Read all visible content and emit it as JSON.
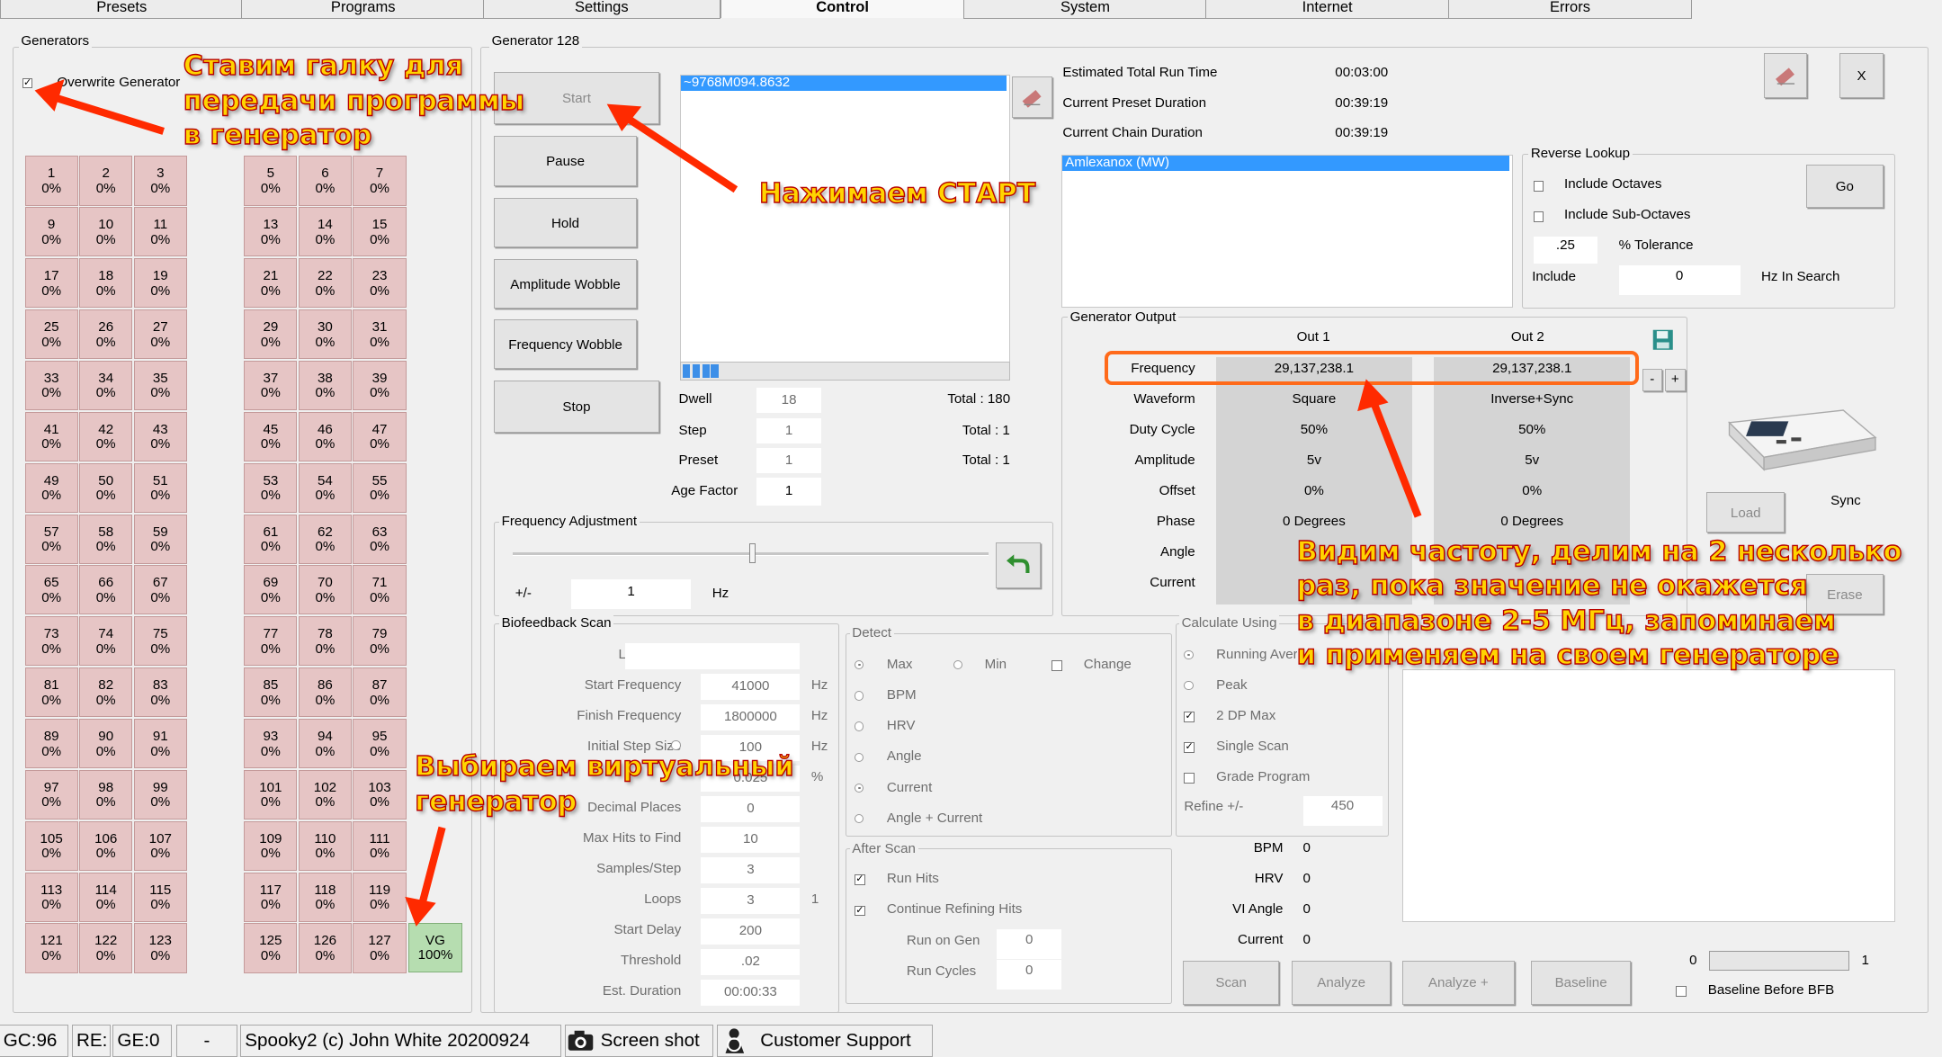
{
  "tabs": [
    {
      "label": "Presets"
    },
    {
      "label": "Programs"
    },
    {
      "label": "Settings"
    },
    {
      "label": "Control"
    },
    {
      "label": "System"
    },
    {
      "label": "Internet"
    },
    {
      "label": "Errors"
    }
  ],
  "generators": {
    "title": "Generators",
    "overwrite_label": "Overwrite Generator",
    "overwrite_checked": true,
    "cells_left": [
      {
        "num": "1",
        "pct": "0%"
      },
      {
        "num": "2",
        "pct": "0%"
      },
      {
        "num": "3",
        "pct": "0%"
      },
      {
        "num": "9",
        "pct": "0%"
      },
      {
        "num": "10",
        "pct": "0%"
      },
      {
        "num": "11",
        "pct": "0%"
      },
      {
        "num": "17",
        "pct": "0%"
      },
      {
        "num": "18",
        "pct": "0%"
      },
      {
        "num": "19",
        "pct": "0%"
      },
      {
        "num": "25",
        "pct": "0%"
      },
      {
        "num": "26",
        "pct": "0%"
      },
      {
        "num": "27",
        "pct": "0%"
      },
      {
        "num": "33",
        "pct": "0%"
      },
      {
        "num": "34",
        "pct": "0%"
      },
      {
        "num": "35",
        "pct": "0%"
      },
      {
        "num": "41",
        "pct": "0%"
      },
      {
        "num": "42",
        "pct": "0%"
      },
      {
        "num": "43",
        "pct": "0%"
      },
      {
        "num": "49",
        "pct": "0%"
      },
      {
        "num": "50",
        "pct": "0%"
      },
      {
        "num": "51",
        "pct": "0%"
      },
      {
        "num": "57",
        "pct": "0%"
      },
      {
        "num": "58",
        "pct": "0%"
      },
      {
        "num": "59",
        "pct": "0%"
      },
      {
        "num": "65",
        "pct": "0%"
      },
      {
        "num": "66",
        "pct": "0%"
      },
      {
        "num": "67",
        "pct": "0%"
      },
      {
        "num": "73",
        "pct": "0%"
      },
      {
        "num": "74",
        "pct": "0%"
      },
      {
        "num": "75",
        "pct": "0%"
      },
      {
        "num": "81",
        "pct": "0%"
      },
      {
        "num": "82",
        "pct": "0%"
      },
      {
        "num": "83",
        "pct": "0%"
      },
      {
        "num": "89",
        "pct": "0%"
      },
      {
        "num": "90",
        "pct": "0%"
      },
      {
        "num": "91",
        "pct": "0%"
      },
      {
        "num": "97",
        "pct": "0%"
      },
      {
        "num": "98",
        "pct": "0%"
      },
      {
        "num": "99",
        "pct": "0%"
      },
      {
        "num": "105",
        "pct": "0%"
      },
      {
        "num": "106",
        "pct": "0%"
      },
      {
        "num": "107",
        "pct": "0%"
      },
      {
        "num": "113",
        "pct": "0%"
      },
      {
        "num": "114",
        "pct": "0%"
      },
      {
        "num": "115",
        "pct": "0%"
      },
      {
        "num": "121",
        "pct": "0%"
      },
      {
        "num": "122",
        "pct": "0%"
      },
      {
        "num": "123",
        "pct": "0%"
      }
    ],
    "cells_right": [
      {
        "num": "5",
        "pct": "0%"
      },
      {
        "num": "6",
        "pct": "0%"
      },
      {
        "num": "7",
        "pct": "0%"
      },
      {
        "num": "13",
        "pct": "0%"
      },
      {
        "num": "14",
        "pct": "0%"
      },
      {
        "num": "15",
        "pct": "0%"
      },
      {
        "num": "21",
        "pct": "0%"
      },
      {
        "num": "22",
        "pct": "0%"
      },
      {
        "num": "23",
        "pct": "0%"
      },
      {
        "num": "29",
        "pct": "0%"
      },
      {
        "num": "30",
        "pct": "0%"
      },
      {
        "num": "31",
        "pct": "0%"
      },
      {
        "num": "37",
        "pct": "0%"
      },
      {
        "num": "38",
        "pct": "0%"
      },
      {
        "num": "39",
        "pct": "0%"
      },
      {
        "num": "45",
        "pct": "0%"
      },
      {
        "num": "46",
        "pct": "0%"
      },
      {
        "num": "47",
        "pct": "0%"
      },
      {
        "num": "53",
        "pct": "0%"
      },
      {
        "num": "54",
        "pct": "0%"
      },
      {
        "num": "55",
        "pct": "0%"
      },
      {
        "num": "61",
        "pct": "0%"
      },
      {
        "num": "62",
        "pct": "0%"
      },
      {
        "num": "63",
        "pct": "0%"
      },
      {
        "num": "69",
        "pct": "0%"
      },
      {
        "num": "70",
        "pct": "0%"
      },
      {
        "num": "71",
        "pct": "0%"
      },
      {
        "num": "77",
        "pct": "0%"
      },
      {
        "num": "78",
        "pct": "0%"
      },
      {
        "num": "79",
        "pct": "0%"
      },
      {
        "num": "85",
        "pct": "0%"
      },
      {
        "num": "86",
        "pct": "0%"
      },
      {
        "num": "87",
        "pct": "0%"
      },
      {
        "num": "93",
        "pct": "0%"
      },
      {
        "num": "94",
        "pct": "0%"
      },
      {
        "num": "95",
        "pct": "0%"
      },
      {
        "num": "101",
        "pct": "0%"
      },
      {
        "num": "102",
        "pct": "0%"
      },
      {
        "num": "103",
        "pct": "0%"
      },
      {
        "num": "109",
        "pct": "0%"
      },
      {
        "num": "110",
        "pct": "0%"
      },
      {
        "num": "111",
        "pct": "0%"
      },
      {
        "num": "117",
        "pct": "0%"
      },
      {
        "num": "118",
        "pct": "0%"
      },
      {
        "num": "119",
        "pct": "0%"
      },
      {
        "num": "125",
        "pct": "0%"
      },
      {
        "num": "126",
        "pct": "0%"
      },
      {
        "num": "127",
        "pct": "0%"
      }
    ],
    "vg_cell": {
      "num": "VG",
      "pct": "100%"
    }
  },
  "generator": {
    "title": "Generator 128",
    "buttons": {
      "start": "Start",
      "pause": "Pause",
      "hold": "Hold",
      "amp_wobble": "Amplitude Wobble",
      "freq_wobble": "Frequency Wobble",
      "stop": "Stop"
    },
    "program_list_item": "~9768M094.8632",
    "dwell_label": "Dwell",
    "dwell_value": "18",
    "dwell_total": "Total : 180",
    "step_label": "Step",
    "step_value": "1",
    "step_total": "Total : 1",
    "preset_label": "Preset",
    "preset_value": "1",
    "preset_total": "Total : 1",
    "age_label": "Age Factor",
    "age_value": "1"
  },
  "run_info": {
    "est_label": "Estimated Total Run Time",
    "est_value": "00:03:00",
    "preset_dur_label": "Current Preset Duration",
    "preset_dur_value": "00:39:19",
    "chain_dur_label": "Current Chain Duration",
    "chain_dur_value": "00:39:19",
    "close_label": "X",
    "program_item": "Amlexanox (MW)"
  },
  "reverse_lookup": {
    "title": "Reverse Lookup",
    "include_octaves": "Include Octaves",
    "include_sub_octaves": "Include Sub-Octaves",
    "tolerance_value": ".25",
    "tolerance_label": "% Tolerance",
    "include_label": "Include",
    "include_value": "0",
    "hz_label": "Hz In Search",
    "go_label": "Go"
  },
  "generator_output": {
    "title": "Generator Output",
    "col1": "Out 1",
    "col2": "Out 2",
    "rows": [
      {
        "label": "Frequency",
        "out1": "29,137,238.1",
        "out2": "29,137,238.1"
      },
      {
        "label": "Waveform",
        "out1": "Square",
        "out2": "Inverse+Sync"
      },
      {
        "label": "Duty Cycle",
        "out1": "50%",
        "out2": "50%"
      },
      {
        "label": "Amplitude",
        "out1": "5v",
        "out2": "5v"
      },
      {
        "label": "Offset",
        "out1": "0%",
        "out2": "0%"
      },
      {
        "label": "Phase",
        "out1": "0 Degrees",
        "out2": "0 Degrees"
      },
      {
        "label": "Angle",
        "out1": "",
        "out2": ""
      },
      {
        "label": "Current",
        "out1": "",
        "out2": ""
      }
    ],
    "minus": "-",
    "plus": "+"
  },
  "device": {
    "sync_label": "Sync",
    "load_label": "Load",
    "erase_label": "Erase"
  },
  "freq_adjust": {
    "title": "Frequency Adjustment",
    "pm_label": "+/-",
    "value": "1",
    "unit": "Hz"
  },
  "biofeedback": {
    "title": "Biofeedback Scan",
    "rows": [
      {
        "label": "Log Name",
        "value": "",
        "unit": ""
      },
      {
        "label": "Start Frequency",
        "value": "41000",
        "unit": "Hz"
      },
      {
        "label": "Finish Frequency",
        "value": "1800000",
        "unit": "Hz"
      },
      {
        "label": "Initial Step Size",
        "value": "100",
        "unit": "Hz"
      },
      {
        "label": "",
        "value": "0.025",
        "unit": "%"
      },
      {
        "label": "Decimal Places",
        "value": "0",
        "unit": ""
      },
      {
        "label": "Max Hits to Find",
        "value": "10",
        "unit": ""
      },
      {
        "label": "Samples/Step",
        "value": "3",
        "unit": ""
      },
      {
        "label": "Loops",
        "value": "3",
        "unit": "1"
      },
      {
        "label": "Start Delay",
        "value": "200",
        "unit": ""
      },
      {
        "label": "Threshold",
        "value": ".02",
        "unit": ""
      },
      {
        "label": "Est. Duration",
        "value": "00:00:33",
        "unit": ""
      }
    ]
  },
  "detect": {
    "title": "Detect",
    "max": "Max",
    "min": "Min",
    "change": "Change",
    "options": [
      "BPM",
      "HRV",
      "Angle",
      "Current",
      "Angle + Current"
    ]
  },
  "after_scan": {
    "title": "After Scan",
    "run_hits": "Run Hits",
    "continue": "Continue Refining Hits",
    "run_on_gen": "Run on Gen",
    "run_on_gen_value": "0",
    "run_cycles": "Run Cycles",
    "run_cycles_value": "0"
  },
  "calc": {
    "title": "Calculate Using",
    "options": [
      "Running Average",
      "Peak",
      "2 DP Max",
      "Single Scan",
      "Grade Program"
    ],
    "refine_label": "Refine +/-",
    "refine_value": "450"
  },
  "readings": [
    {
      "label": "BPM",
      "value": "0"
    },
    {
      "label": "HRV",
      "value": "0"
    },
    {
      "label": "VI Angle",
      "value": "0"
    },
    {
      "label": "Current",
      "value": "0"
    }
  ],
  "scan_buttons": {
    "scan": "Scan",
    "analyze": "Analyze",
    "analyze_plus": "Analyze +",
    "baseline": "Baseline"
  },
  "baseline": {
    "min": "0",
    "max": "1",
    "before_label": "Baseline Before BFB"
  },
  "status": {
    "gc": "GC:96",
    "re": "RE:",
    "ge": "GE:0",
    "dash": "-",
    "credit": "Spooky2 (c) John White 20200924",
    "screenshot": "Screen shot",
    "support": "Customer Support"
  },
  "annotations": {
    "a1": [
      "Ставим галку для",
      "передачи программы",
      "в генератор"
    ],
    "a2": "Нажимаем СТАРТ",
    "a3": [
      "Видим частоту, делим на 2 несколько",
      "раз, пока значение не окажется",
      "в диапазоне 2-5 МГц, запоминаем",
      "и применяем на своем генераторе"
    ],
    "a4": [
      "Выбираем виртуальный",
      "генератор"
    ]
  },
  "colors": {
    "selection": "#3399ff",
    "cell": "#e6c5c5",
    "vg_cell": "#b6ddb0",
    "annotation_text": "#ffd400",
    "annotation_outline": "#b80000"
  }
}
